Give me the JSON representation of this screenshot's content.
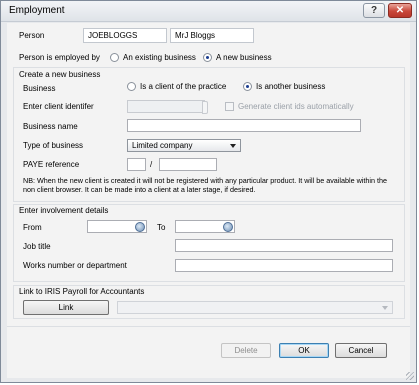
{
  "window": {
    "title": "Employment",
    "help_label": "?",
    "close_label": "✕"
  },
  "person": {
    "label": "Person",
    "code": "JOEBLOGGS",
    "name": "MrJ Bloggs"
  },
  "employed_by": {
    "label": "Person is employed by",
    "options": [
      "An existing business",
      "A new business"
    ],
    "selected": "A new business"
  },
  "new_business": {
    "group_label": "Create a new business",
    "business_label": "Business",
    "business_options": [
      "Is a client of the practice",
      "Is another business"
    ],
    "business_selected": "Is another business",
    "client_identifier_label": "Enter client identifer",
    "client_identifier_value": "",
    "generate_ids_label": "Generate client ids automatically",
    "business_name_label": "Business name",
    "business_name_value": "",
    "type_label": "Type of business",
    "type_value": "Limited company",
    "paye_label": "PAYE reference",
    "paye_part1": "",
    "paye_separator": "/",
    "paye_part2": "",
    "note": "NB: When the new client is created it will not be registered with any particular product. It will be available within the non client browser. It can be made into a client at a later stage, if desired."
  },
  "involvement": {
    "group_label": "Enter involvement details",
    "from_label": "From",
    "from_value": "",
    "to_label": "To",
    "to_value": "",
    "job_title_label": "Job title",
    "job_title_value": "",
    "works_label": "Works number or department",
    "works_value": ""
  },
  "payroll": {
    "group_label": "Link to IRIS Payroll for Accountants",
    "link_label": "Link",
    "select_value": ""
  },
  "footer": {
    "delete_label": "Delete",
    "ok_label": "OK",
    "cancel_label": "Cancel"
  },
  "icons": {
    "help": "help-icon",
    "close": "close-icon",
    "calendar": "calendar-icon",
    "dropdown": "chevron-down-icon",
    "grip": "resize-grip-icon"
  }
}
